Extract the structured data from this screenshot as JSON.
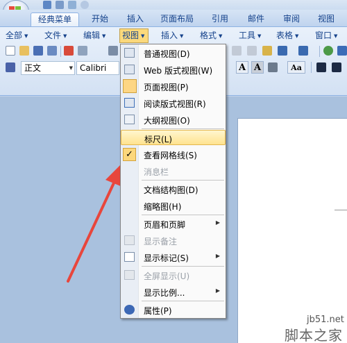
{
  "tabs": [
    "经典菜单",
    "开始",
    "插入",
    "页面布局",
    "引用",
    "邮件",
    "审阅",
    "视图"
  ],
  "menubar": [
    "全部",
    "文件",
    "编辑",
    "视图",
    "插入",
    "格式",
    "工具",
    "表格",
    "窗口"
  ],
  "format_bar": {
    "style_value": "正文",
    "font_value": "Calibri (西文",
    "letters": [
      "A",
      "A",
      "Aa"
    ]
  },
  "dropdown": {
    "items": [
      {
        "label": "普通视图(D)",
        "icon": "normal-view-icon"
      },
      {
        "label": "Web 版式视图(W)",
        "icon": "web-view-icon"
      },
      {
        "label": "页面视图(P)",
        "icon": "page-view-icon",
        "selected": true
      },
      {
        "label": "阅读版式视图(R)",
        "icon": "reading-view-icon"
      },
      {
        "label": "大纲视图(O)",
        "icon": "outline-view-icon"
      },
      {
        "label": "标尺(L)",
        "highlighted": true
      },
      {
        "label": "查看网格线(S)",
        "checked": true,
        "check": "✓"
      },
      {
        "label": "消息栏",
        "disabled": true
      },
      {
        "label": "文档结构图(D)"
      },
      {
        "label": "缩略图(H)"
      },
      {
        "label": "页眉和页脚",
        "submenu": true
      },
      {
        "label": "显示备注",
        "disabled": true,
        "icon": "notes-icon"
      },
      {
        "label": "显示标记(S)",
        "submenu": true,
        "icon": "markup-icon"
      },
      {
        "label": "全屏显示(U)",
        "disabled": true,
        "icon": "fullscreen-icon"
      },
      {
        "label": "显示比例...",
        "submenu": true
      },
      {
        "label": "属性(P)",
        "icon": "properties-icon"
      }
    ]
  },
  "watermark": {
    "url": "jb51.net",
    "name": "脚本之家"
  },
  "colors": {
    "accent": "#fbd97c",
    "ribbon": "#d3e1f3",
    "arrow": "#e8463c"
  }
}
